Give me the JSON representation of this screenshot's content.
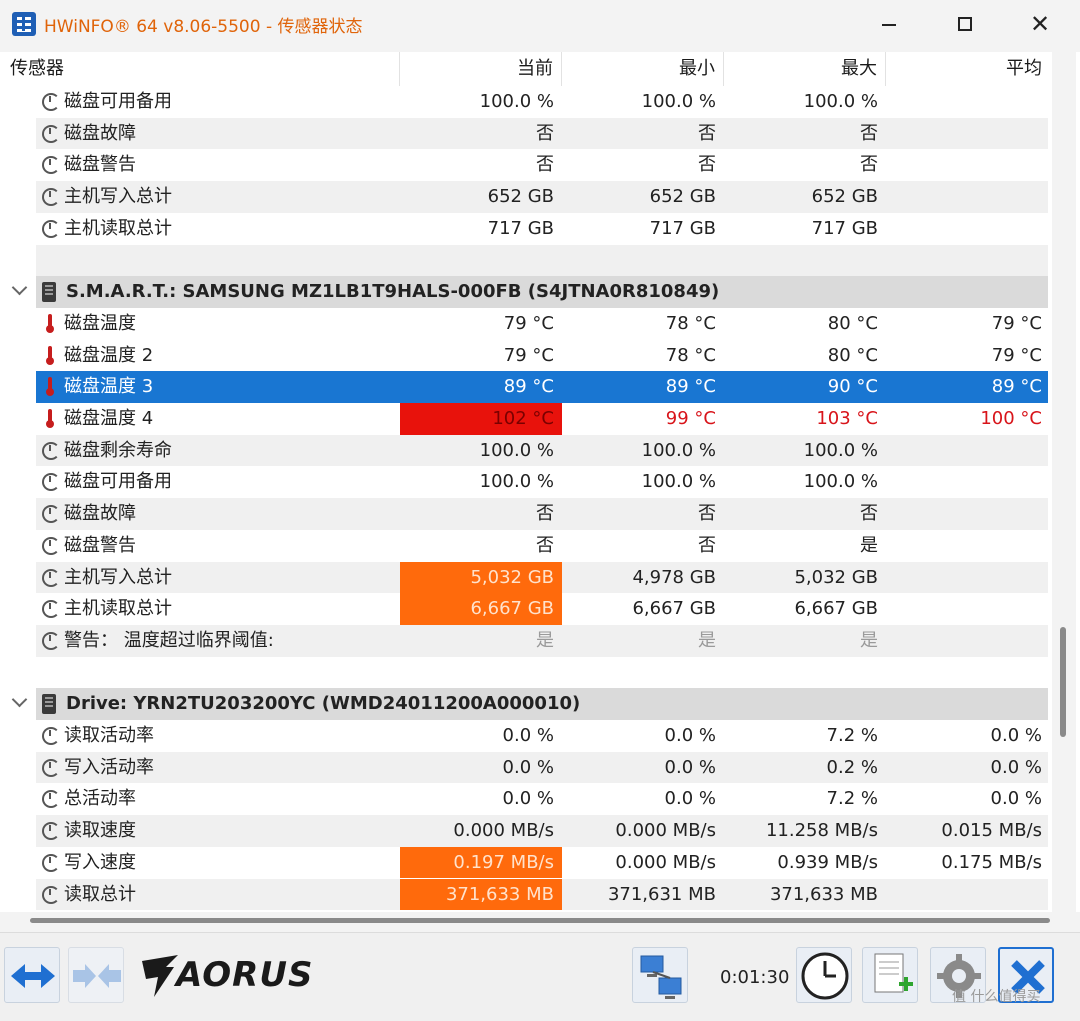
{
  "window": {
    "title": "HWiNFO® 64 v8.06-5500 - 传感器状态",
    "min_glyph": "",
    "max_glyph": "",
    "close_glyph": "✕"
  },
  "columns": {
    "sensor": "传感器",
    "current": "当前",
    "min": "最小",
    "max": "最大",
    "avg": "平均"
  },
  "rows": [
    {
      "kind": "row",
      "icon": "clock-icon",
      "name": "磁盘可用备用",
      "values": [
        "100.0 %",
        "100.0 %",
        "100.0 %",
        ""
      ],
      "alt": false
    },
    {
      "kind": "row",
      "icon": "clock-icon",
      "name": "磁盘故障",
      "values": [
        "否",
        "否",
        "否",
        ""
      ],
      "alt": true
    },
    {
      "kind": "row",
      "icon": "clock-icon",
      "name": "磁盘警告",
      "values": [
        "否",
        "否",
        "否",
        ""
      ],
      "alt": false
    },
    {
      "kind": "row",
      "icon": "clock-icon",
      "name": "主机写入总计",
      "values": [
        "652 GB",
        "652 GB",
        "652 GB",
        ""
      ],
      "alt": true
    },
    {
      "kind": "row",
      "icon": "clock-icon",
      "name": "主机读取总计",
      "values": [
        "717 GB",
        "717 GB",
        "717 GB",
        ""
      ],
      "alt": false
    },
    {
      "kind": "blank",
      "alt": true
    },
    {
      "kind": "group",
      "name": "S.M.A.R.T.: SAMSUNG MZ1LB1T9HALS-000FB (S4JTNA0R810849)"
    },
    {
      "kind": "row",
      "icon": "thermometer-icon",
      "name": "磁盘温度",
      "values": [
        "79 °C",
        "78 °C",
        "80 °C",
        "79 °C"
      ],
      "alt": false
    },
    {
      "kind": "row",
      "icon": "thermometer-icon",
      "name": "磁盘温度 2",
      "values": [
        "79 °C",
        "78 °C",
        "80 °C",
        "79 °C"
      ],
      "alt": false
    },
    {
      "kind": "row",
      "icon": "thermometer-icon",
      "name": "磁盘温度 3",
      "values": [
        "89 °C",
        "89 °C",
        "90 °C",
        "89 °C"
      ],
      "alt": false,
      "selected": true
    },
    {
      "kind": "row",
      "icon": "thermometer-icon",
      "name": "磁盘温度 4",
      "values": [
        "102 °C",
        "99 °C",
        "103 °C",
        "100 °C"
      ],
      "alt": false,
      "alarm": true
    },
    {
      "kind": "row",
      "icon": "clock-icon",
      "name": "磁盘剩余寿命",
      "values": [
        "100.0 %",
        "100.0 %",
        "100.0 %",
        ""
      ],
      "alt": true
    },
    {
      "kind": "row",
      "icon": "clock-icon",
      "name": "磁盘可用备用",
      "values": [
        "100.0 %",
        "100.0 %",
        "100.0 %",
        ""
      ],
      "alt": false
    },
    {
      "kind": "row",
      "icon": "clock-icon",
      "name": "磁盘故障",
      "values": [
        "否",
        "否",
        "否",
        ""
      ],
      "alt": true
    },
    {
      "kind": "row",
      "icon": "clock-icon",
      "name": "磁盘警告",
      "values": [
        "否",
        "否",
        "是",
        ""
      ],
      "alt": false
    },
    {
      "kind": "row",
      "icon": "clock-icon",
      "name": "主机写入总计",
      "values": [
        "5,032 GB",
        "4,978 GB",
        "5,032 GB",
        ""
      ],
      "alt": true,
      "orange": true
    },
    {
      "kind": "row",
      "icon": "clock-icon",
      "name": "主机读取总计",
      "values": [
        "6,667 GB",
        "6,667 GB",
        "6,667 GB",
        ""
      ],
      "alt": false,
      "orange": true
    },
    {
      "kind": "row",
      "icon": "clock-icon",
      "name": "警告：  温度超过临界阈值:",
      "values": [
        "是",
        "是",
        "是",
        ""
      ],
      "alt": true,
      "gray": true
    },
    {
      "kind": "blank",
      "alt": false
    },
    {
      "kind": "group",
      "name": "Drive: YRN2TU203200YC (WMD24011200A000010)"
    },
    {
      "kind": "row",
      "icon": "clock-icon",
      "name": "读取活动率",
      "values": [
        "0.0 %",
        "0.0 %",
        "7.2 %",
        "0.0 %"
      ],
      "alt": false
    },
    {
      "kind": "row",
      "icon": "clock-icon",
      "name": "写入活动率",
      "values": [
        "0.0 %",
        "0.0 %",
        "0.2 %",
        "0.0 %"
      ],
      "alt": true
    },
    {
      "kind": "row",
      "icon": "clock-icon",
      "name": "总活动率",
      "values": [
        "0.0 %",
        "0.0 %",
        "7.2 %",
        "0.0 %"
      ],
      "alt": false
    },
    {
      "kind": "row",
      "icon": "clock-icon",
      "name": "读取速度",
      "values": [
        "0.000 MB/s",
        "0.000 MB/s",
        "11.258 MB/s",
        "0.015 MB/s"
      ],
      "alt": true
    },
    {
      "kind": "row",
      "icon": "clock-icon",
      "name": "写入速度",
      "values": [
        "0.197 MB/s",
        "0.000 MB/s",
        "0.939 MB/s",
        "0.175 MB/s"
      ],
      "alt": false,
      "orange": true
    },
    {
      "kind": "row",
      "icon": "clock-icon",
      "name": "读取总计",
      "values": [
        "371,633 MB",
        "371,631 MB",
        "371,633 MB",
        ""
      ],
      "alt": true,
      "orange": true
    }
  ],
  "toolbar": {
    "brand": "AORUS",
    "timer": "0:01:30",
    "watermark": "值 什么值得买"
  },
  "colors": {
    "title_accent": "#e0640a",
    "selected_row": "#1976d2",
    "alarm_red": "#e8120c",
    "highlight_orange": "#ff6a0c"
  }
}
